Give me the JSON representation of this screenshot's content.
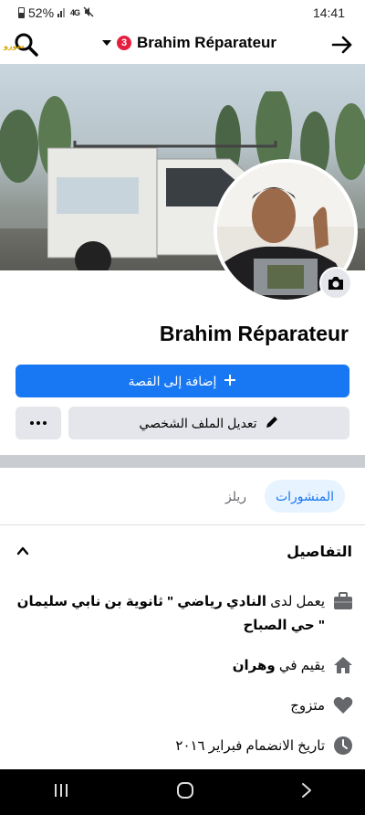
{
  "status_bar": {
    "battery": "52%",
    "network": "4G",
    "time": "14:41",
    "icons": [
      "battery-icon",
      "signal-icon",
      "mute-icon"
    ]
  },
  "header": {
    "logo_text": "سوزو",
    "notification_count": "3",
    "title": "Brahim Réparateur",
    "icons": [
      "search-icon",
      "caret-down-icon",
      "arrow-right-icon"
    ]
  },
  "profile": {
    "name": "Brahim Réparateur"
  },
  "actions": {
    "add_story": "إضافة إلى القصة",
    "edit_profile": "تعديل الملف الشخصي",
    "more_icon": "more-dots-icon"
  },
  "tabs": [
    {
      "label": "المنشورات",
      "active": true
    },
    {
      "label": "ريلز",
      "active": false
    }
  ],
  "details": {
    "title": "التفاصيل",
    "work": {
      "prefix": "يعمل لدى",
      "bold": "النادي رياضي \" ثانوية بن نابي سليمان \" حي الصباح",
      "icon": "briefcase-icon"
    },
    "location": {
      "prefix": "يقيم في",
      "bold": "وهران",
      "icon": "home-icon"
    },
    "relationship": {
      "text": "متزوج",
      "icon": "heart-icon"
    },
    "joined": {
      "text": "تاريخ الانضمام فبراير ٢٠١٦",
      "icon": "clock-icon"
    }
  },
  "colors": {
    "primary": "#1877f2",
    "button_gray": "#e4e6eb",
    "badge": "#e41e3f",
    "tab_active_bg": "#e7f3ff"
  }
}
